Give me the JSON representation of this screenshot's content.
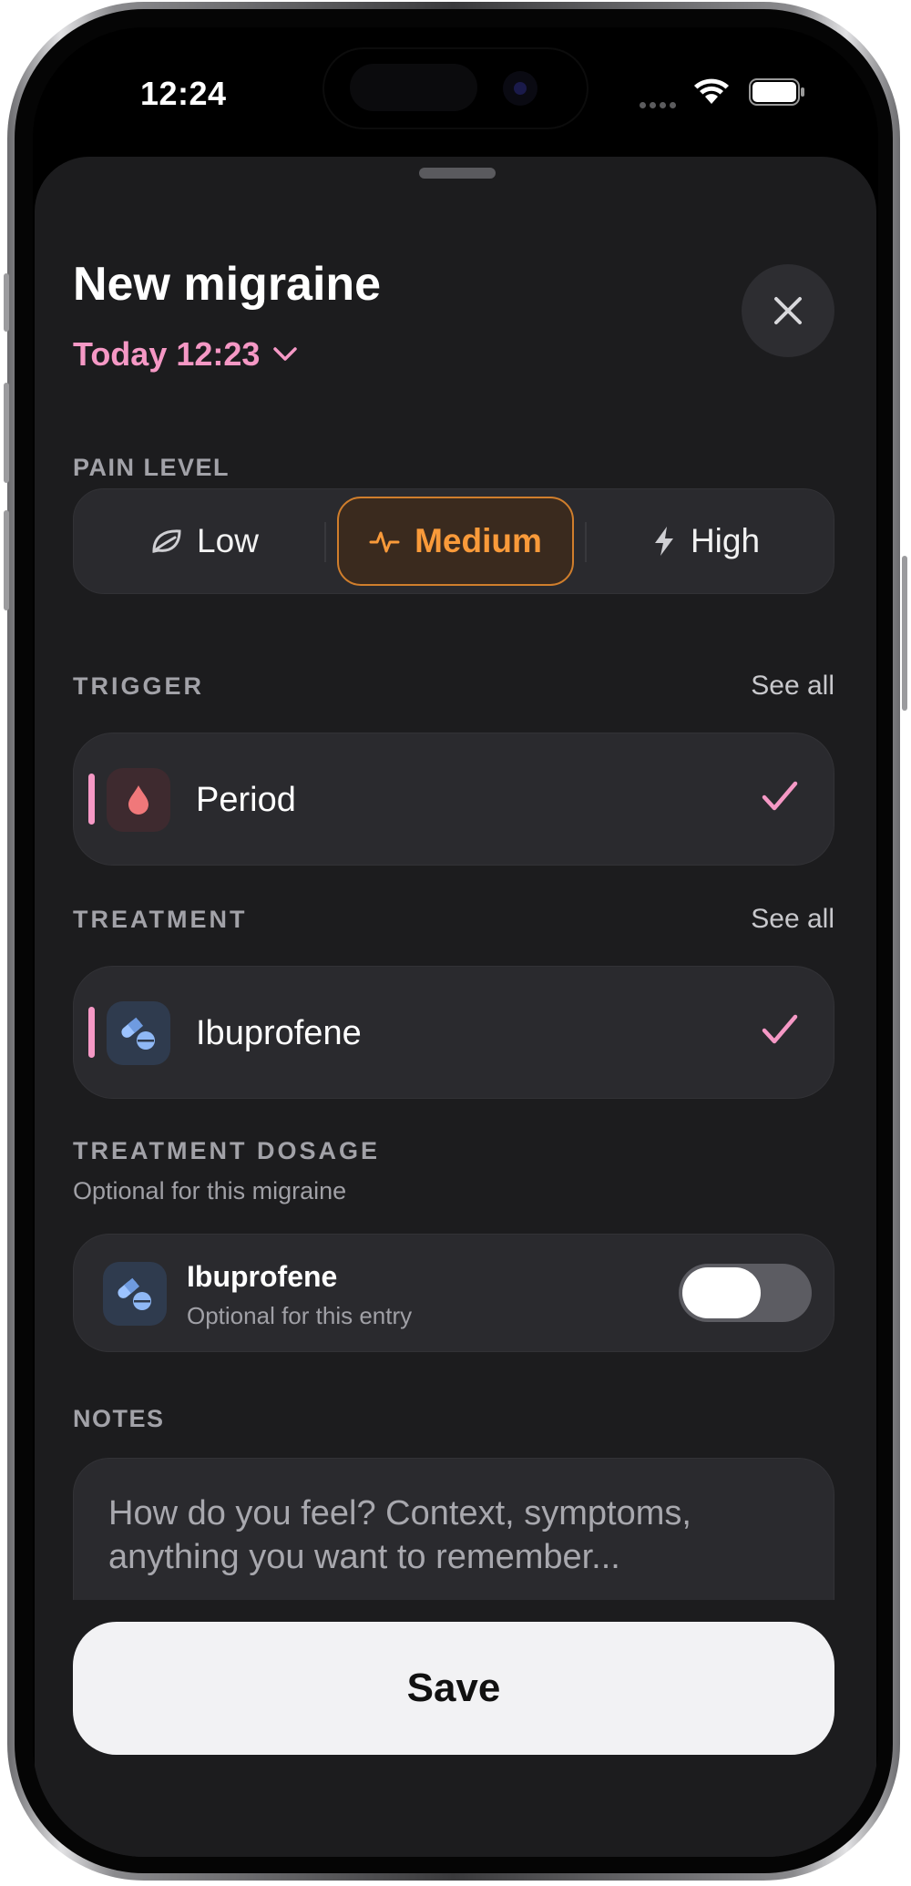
{
  "status_bar": {
    "time": "12:24"
  },
  "sheet": {
    "title": "New migraine",
    "date_label": "Today 12:23"
  },
  "pain_level": {
    "label": "PAIN LEVEL",
    "options": [
      {
        "label": "Low",
        "icon": "leaf-icon",
        "selected": false
      },
      {
        "label": "Medium",
        "icon": "pulse-icon",
        "selected": true
      },
      {
        "label": "High",
        "icon": "bolt-icon",
        "selected": false
      }
    ]
  },
  "trigger": {
    "label": "TRIGGER",
    "see_all": "See all",
    "item": {
      "label": "Period",
      "icon": "drop-icon",
      "checked": true
    }
  },
  "treatment": {
    "label": "TREATMENT",
    "see_all": "See all",
    "item": {
      "label": "Ibuprofene",
      "icon": "pill-icon",
      "checked": true
    }
  },
  "treatment_dosage": {
    "label": "TREATMENT DOSAGE",
    "subtitle": "Optional for this migraine",
    "item": {
      "title": "Ibuprofene",
      "subtitle": "Optional for this entry",
      "enabled": false
    }
  },
  "notes": {
    "label": "NOTES",
    "placeholder": "How do you feel? Context, symptoms, anything you want to remember..."
  },
  "actions": {
    "save_label": "Save"
  },
  "colors": {
    "accent_pink": "#f598c5",
    "accent_orange": "#f99a3a",
    "sheet_bg": "#1c1c1e",
    "card_bg": "#2a2a2e"
  }
}
